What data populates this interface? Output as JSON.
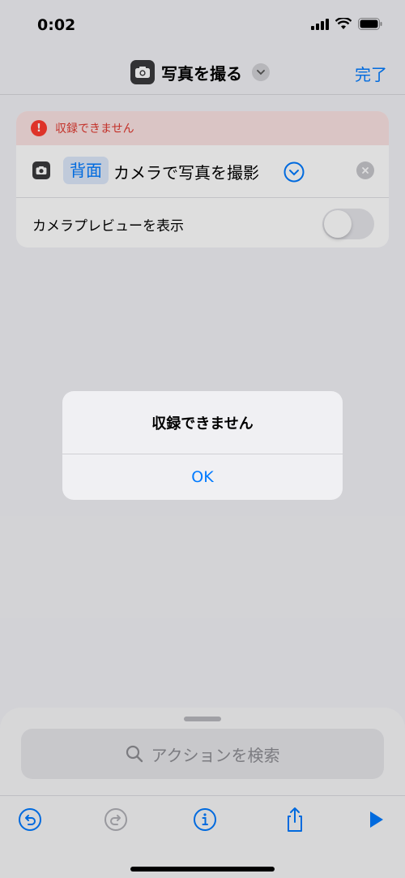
{
  "status_bar": {
    "time": "0:02"
  },
  "nav": {
    "title": "写真を撮る",
    "done_label": "完了"
  },
  "card": {
    "error_text": "収録できません",
    "param_label": "背面",
    "action_text": "カメラで写真を撮影",
    "toggle_label": "カメラプレビューを表示",
    "toggle_on": false
  },
  "search": {
    "placeholder": "アクションを検索"
  },
  "alert": {
    "title": "収録できません",
    "ok_label": "OK"
  },
  "colors": {
    "accent": "#007aff",
    "error": "#ff3b30"
  },
  "icons": [
    "camera-icon",
    "chevron-down-icon",
    "error-icon",
    "close-icon",
    "search-icon",
    "undo-icon",
    "redo-icon",
    "info-icon",
    "share-icon",
    "play-icon"
  ]
}
